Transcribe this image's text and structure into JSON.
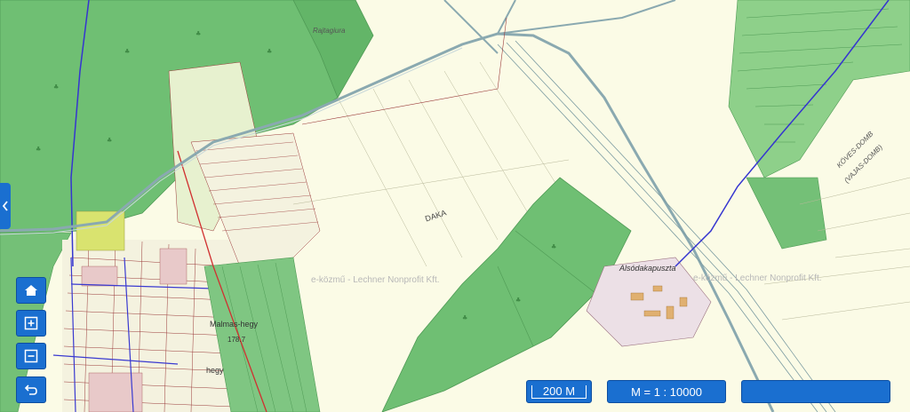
{
  "map": {
    "place_labels": {
      "top": "Rajtagiura",
      "daka": "DAKA",
      "also": "Alsódakapuszta",
      "komes1": "KÖVES-DOMB",
      "komes2": "(VAJAS-DOMB)",
      "malmas": "Malmas-hegy",
      "elev": "178.7",
      "bottom": "hegy"
    },
    "watermark": "e-közmű - Lechner Nonprofit Kft."
  },
  "controls": {
    "home_icon": "home-icon",
    "zoom_in_icon": "zoom-in-icon",
    "zoom_out_icon": "zoom-out-icon",
    "back_icon": "back-arrow-icon",
    "collapse_icon": "chevron-left-icon"
  },
  "scalebar": {
    "label": "200 M"
  },
  "scale": {
    "label": "M = 1 : 10000"
  },
  "colors": {
    "button": "#1a6fd0",
    "forest": "#6fbf73",
    "field": "#fbfbe6",
    "road": "#8aa9b0"
  }
}
